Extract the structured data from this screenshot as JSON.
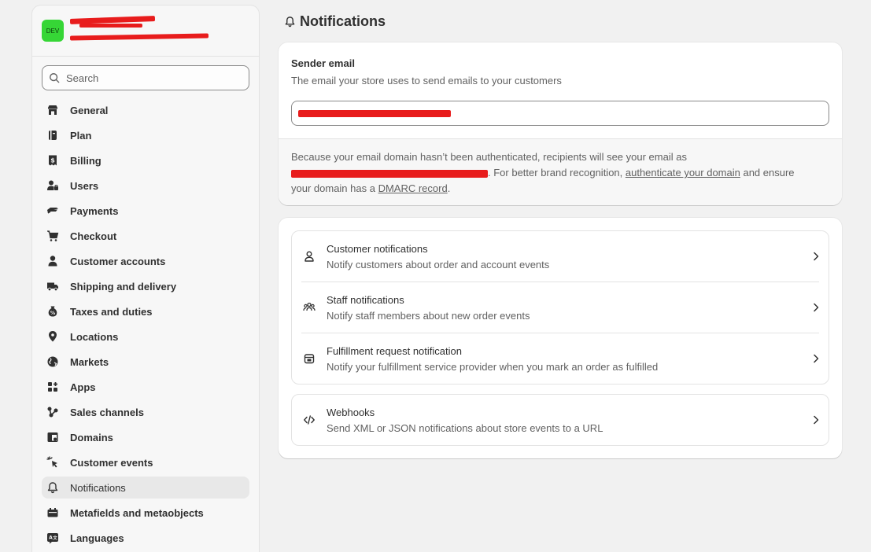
{
  "store": {
    "avatar_text": "DEV"
  },
  "search": {
    "placeholder": "Search"
  },
  "nav": {
    "items": [
      {
        "label": "General",
        "icon": "store-icon"
      },
      {
        "label": "Plan",
        "icon": "plan-icon"
      },
      {
        "label": "Billing",
        "icon": "billing-icon"
      },
      {
        "label": "Users",
        "icon": "users-icon"
      },
      {
        "label": "Payments",
        "icon": "payments-icon"
      },
      {
        "label": "Checkout",
        "icon": "cart-icon"
      },
      {
        "label": "Customer accounts",
        "icon": "person-icon"
      },
      {
        "label": "Shipping and delivery",
        "icon": "truck-icon"
      },
      {
        "label": "Taxes and duties",
        "icon": "tax-icon"
      },
      {
        "label": "Locations",
        "icon": "location-icon"
      },
      {
        "label": "Markets",
        "icon": "globe-icon"
      },
      {
        "label": "Apps",
        "icon": "apps-icon"
      },
      {
        "label": "Sales channels",
        "icon": "channels-icon"
      },
      {
        "label": "Domains",
        "icon": "domains-icon"
      },
      {
        "label": "Customer events",
        "icon": "cursor-icon"
      },
      {
        "label": "Notifications",
        "icon": "bell-icon",
        "active": true
      },
      {
        "label": "Metafields and metaobjects",
        "icon": "metafields-icon"
      },
      {
        "label": "Languages",
        "icon": "languages-icon"
      }
    ]
  },
  "page": {
    "title": "Notifications"
  },
  "sender": {
    "title": "Sender email",
    "description": "The email your store uses to send emails to your customers",
    "footer": {
      "line1": "Because your email domain hasn’t been authenticated, recipients will see your email as",
      "line2_mid": ". For better brand recognition, ",
      "link_authenticate": "authenticate your domain",
      "line2_end": " and ensure",
      "line3_start": "your domain has a ",
      "link_dmarc": "DMARC record",
      "line3_end": "."
    }
  },
  "notifications": [
    {
      "title": "Customer notifications",
      "description": "Notify customers about order and account events",
      "icon": "person-outline-icon"
    },
    {
      "title": "Staff notifications",
      "description": "Notify staff members about new order events",
      "icon": "team-icon"
    },
    {
      "title": "Fulfillment request notification",
      "description": "Notify your fulfillment service provider when you mark an order as fulfilled",
      "icon": "calendar-icon"
    }
  ],
  "webhooks": {
    "title": "Webhooks",
    "description": "Send XML or JSON notifications about store events to a URL",
    "icon": "code-icon"
  },
  "colors": {
    "avatar_bg": "#36d636",
    "redaction": "#e81c1c",
    "active_nav_bg": "#e8e8e8"
  }
}
